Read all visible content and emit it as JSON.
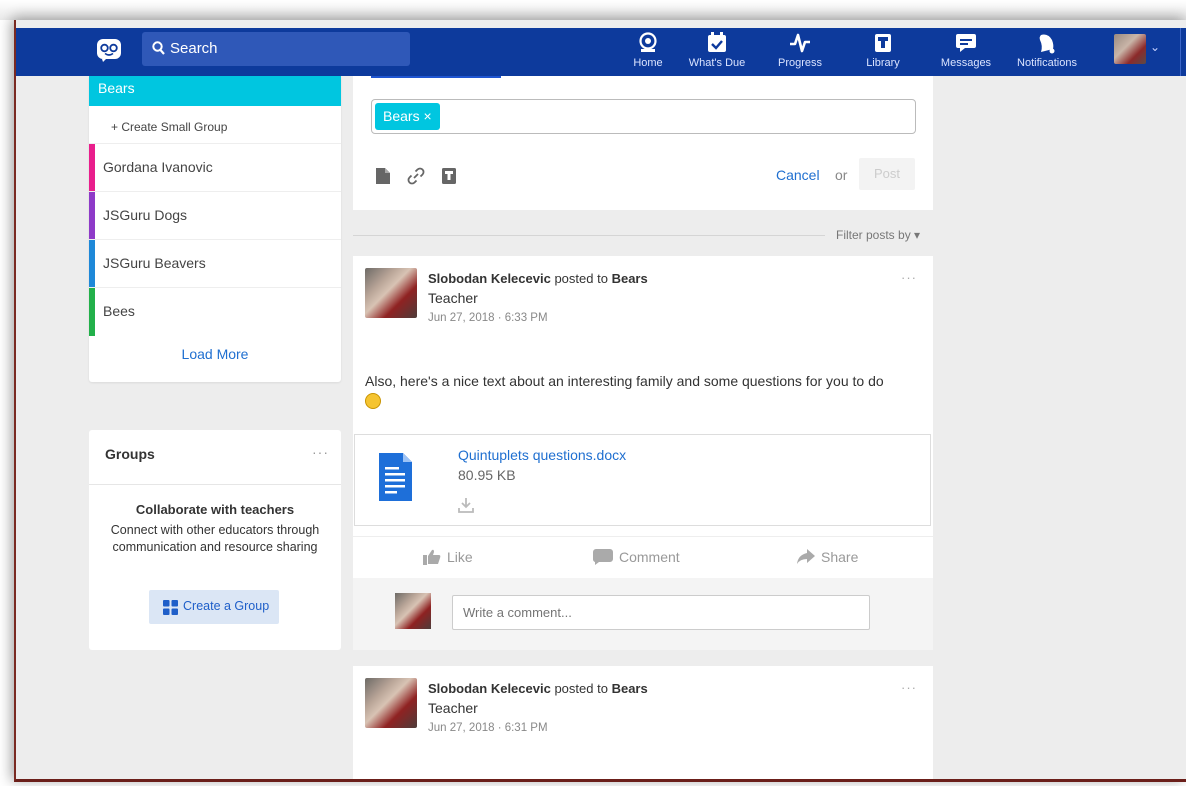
{
  "nav": {
    "search_label": "Search",
    "items": [
      {
        "label": "Home",
        "icon": "home-icon"
      },
      {
        "label": "What's Due",
        "icon": "calendar-check-icon"
      },
      {
        "label": "Progress",
        "icon": "pulse-icon"
      },
      {
        "label": "Library",
        "icon": "library-icon"
      },
      {
        "label": "Messages",
        "icon": "messages-icon"
      },
      {
        "label": "Notifications",
        "icon": "bell-icon"
      }
    ],
    "colors": {
      "bar": "#0d3a9c",
      "search": "#2f58b8"
    }
  },
  "sidebar": {
    "active_group": "Bears",
    "create_small_group": "+ Create Small Group",
    "groups": [
      {
        "label": "Gordana Ivanovic",
        "color": "#e91e8c"
      },
      {
        "label": "JSGuru Dogs",
        "color": "#8e3ac8"
      },
      {
        "label": "JSGuru Beavers",
        "color": "#1e88d8"
      },
      {
        "label": "Bees",
        "color": "#22b04a"
      }
    ],
    "load_more": "Load More"
  },
  "groups_card": {
    "header": "Groups",
    "title": "Collaborate with teachers",
    "description": "Connect with other educators through communication and resource sharing",
    "button": "Create a Group"
  },
  "composer": {
    "tag": "Bears ×",
    "cancel": "Cancel",
    "or": "or",
    "post": "Post"
  },
  "filter": "Filter posts by ▾",
  "posts": [
    {
      "author": "Slobodan Kelecevic",
      "posted_to": "posted to",
      "group": "Bears",
      "role": "Teacher",
      "date": "Jun 27, 2018 · 6:33 PM",
      "text": "Also, here's a nice text about an interesting family and some questions for you to do",
      "attachment": {
        "name": "Quintuplets questions.docx",
        "size": "80.95 KB"
      },
      "actions": {
        "like": "Like",
        "comment": "Comment",
        "share": "Share"
      },
      "comment_placeholder": "Write a comment..."
    },
    {
      "author": "Slobodan Kelecevic",
      "posted_to": "posted to",
      "group": "Bears",
      "role": "Teacher",
      "date": "Jun 27, 2018 · 6:31 PM"
    }
  ]
}
